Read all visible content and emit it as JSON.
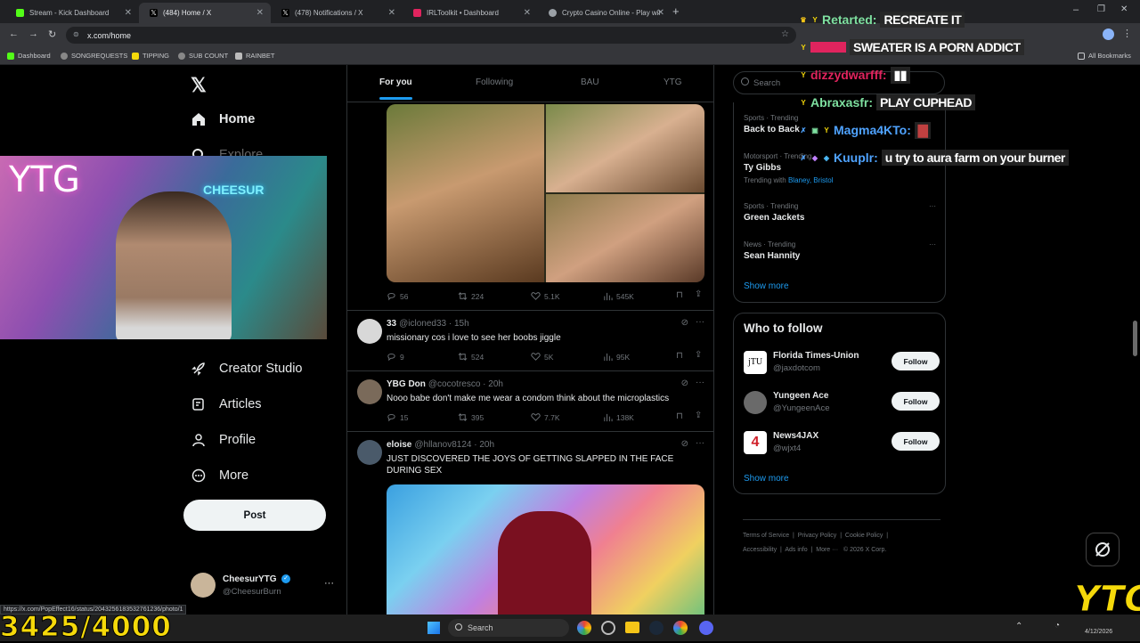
{
  "browser": {
    "tabs": [
      {
        "label": "Stream - Kick Dashboard",
        "color": "#53fc18"
      },
      {
        "label": "(484) Home / X",
        "color": "#ffffff"
      },
      {
        "label": "(478) Notifications / X",
        "color": "#ffffff"
      },
      {
        "label": "IRLToolkit • Dashboard",
        "color": "#e0245e"
      },
      {
        "label": "Crypto Casino Online - Play wit",
        "color": "#9aa0a6"
      }
    ],
    "url": "x.com/home",
    "bookmarks": [
      "Dashboard",
      "SONGREQUESTS",
      "TIPPING",
      "SUB COUNT",
      "RAINBET"
    ],
    "all_bookmarks": "All Bookmarks",
    "status_url": "https://x.com/PopEffect16/status/2043256183532761236/photo/1"
  },
  "nav": {
    "home": "Home",
    "explore": "Explore",
    "creator_studio": "Creator Studio",
    "articles": "Articles",
    "profile": "Profile",
    "more": "More",
    "post": "Post",
    "account_name": "CheesurYTG",
    "account_handle": "@CheesurBurn"
  },
  "feed": {
    "tabs": [
      "For you",
      "Following",
      "BAU",
      "YTG"
    ],
    "post1": {
      "replies": "56",
      "reposts": "224",
      "likes": "5.1K",
      "views": "545K"
    },
    "post2": {
      "name": "33",
      "handle": "@icloned33 · 15h",
      "text": "missionary cos i love to see her boobs jiggle",
      "replies": "9",
      "reposts": "524",
      "likes": "5K",
      "views": "95K"
    },
    "post3": {
      "name": "YBG Don",
      "handle": "@cocotresco · 20h",
      "text": "Nooo babe don't make me wear a condom think about the microplastics",
      "replies": "15",
      "reposts": "395",
      "likes": "7.7K",
      "views": "138K"
    },
    "post4": {
      "name": "eloise",
      "handle": "@hllanov8124 · 20h",
      "text": "JUST DISCOVERED THE JOYS OF GETTING SLAPPED IN THE FACE DURING SEX"
    }
  },
  "sidebar": {
    "search": "Search",
    "trends": [
      {
        "category": "Sports · Trending",
        "title": "Back to Back",
        "with": ""
      },
      {
        "category": "Motorsport · Trending",
        "title": "Ty Gibbs",
        "with": "Blaney, Bristol"
      },
      {
        "category": "Sports · Trending",
        "title": "Green Jackets",
        "with": ""
      },
      {
        "category": "News · Trending",
        "title": "Sean Hannity",
        "with": ""
      }
    ],
    "trending_with": "Trending with",
    "show_more": "Show more",
    "who_to_follow": "Who to follow",
    "follows": [
      {
        "name": "Florida Times-Union",
        "handle": "@jaxdotcom",
        "button": "Follow"
      },
      {
        "name": "Yungeen Ace",
        "handle": "@YungeenAce",
        "button": "Follow"
      },
      {
        "name": "News4JAX",
        "handle": "@wjxt4",
        "button": "Follow"
      }
    ],
    "footer1": [
      "Terms of Service",
      "Privacy Policy",
      "Cookie Policy"
    ],
    "footer2": [
      "Accessibility",
      "Ads info",
      "More ···",
      "© 2026 X Corp."
    ]
  },
  "chat": [
    {
      "user": "Retarted:",
      "msg": "RECREATE IT",
      "color": "#f5c518"
    },
    {
      "user": "",
      "msg": "SWEATER IS A PORN ADDICT",
      "color": "#e0245e"
    },
    {
      "user": "dizzydwarfff:",
      "msg": "",
      "color": "#e0245e"
    },
    {
      "user": "Abraxasfr:",
      "msg": "PLAY CUPHEAD",
      "color": "#7ee0a0"
    },
    {
      "user": "Magma4KTo:",
      "msg": "",
      "color": "#4fa3ff"
    },
    {
      "user": "Kuuplr:",
      "msg": "u try to aura farm on your burner",
      "color": "#4fa3ff"
    }
  ],
  "stream": {
    "subcount": "3425/4000",
    "logo": "YTG",
    "cam_sign1": "YTG",
    "cam_sign2": "CHEESUR"
  },
  "taskbar": {
    "search": "Search",
    "date": "4/12/2026"
  }
}
